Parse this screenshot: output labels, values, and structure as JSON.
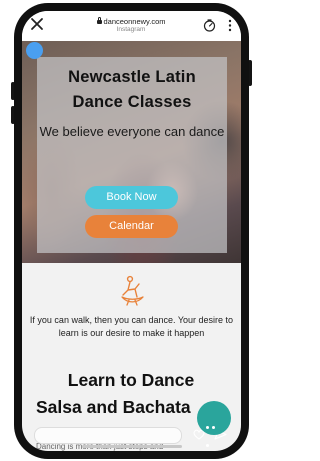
{
  "browser": {
    "url": "danceonnewy.com",
    "subtitle": "Instagram"
  },
  "hero": {
    "title_line1": "Newcastle Latin",
    "title_line2": "Dance Classes",
    "subtitle": "We believe everyone can dance",
    "book_button": "Book Now",
    "calendar_button": "Calendar"
  },
  "content": {
    "tagline": "If you can walk, then you can dance. Your desire to learn is our desire to make it happen",
    "heading_line1": "Learn to Dance",
    "heading_line2": "Salsa and Bachata",
    "description": "Dancing is more than just steps and"
  },
  "colors": {
    "accent_blue": "#4cc7db",
    "accent_orange": "#e8823a",
    "chat_teal": "#2aa59c",
    "dance_icon": "#e8823a"
  },
  "icons": [
    "close-icon",
    "lock-icon",
    "timer-icon",
    "more-icon",
    "dance-couple-icon",
    "chat-icon",
    "heart-icon",
    "send-icon"
  ]
}
